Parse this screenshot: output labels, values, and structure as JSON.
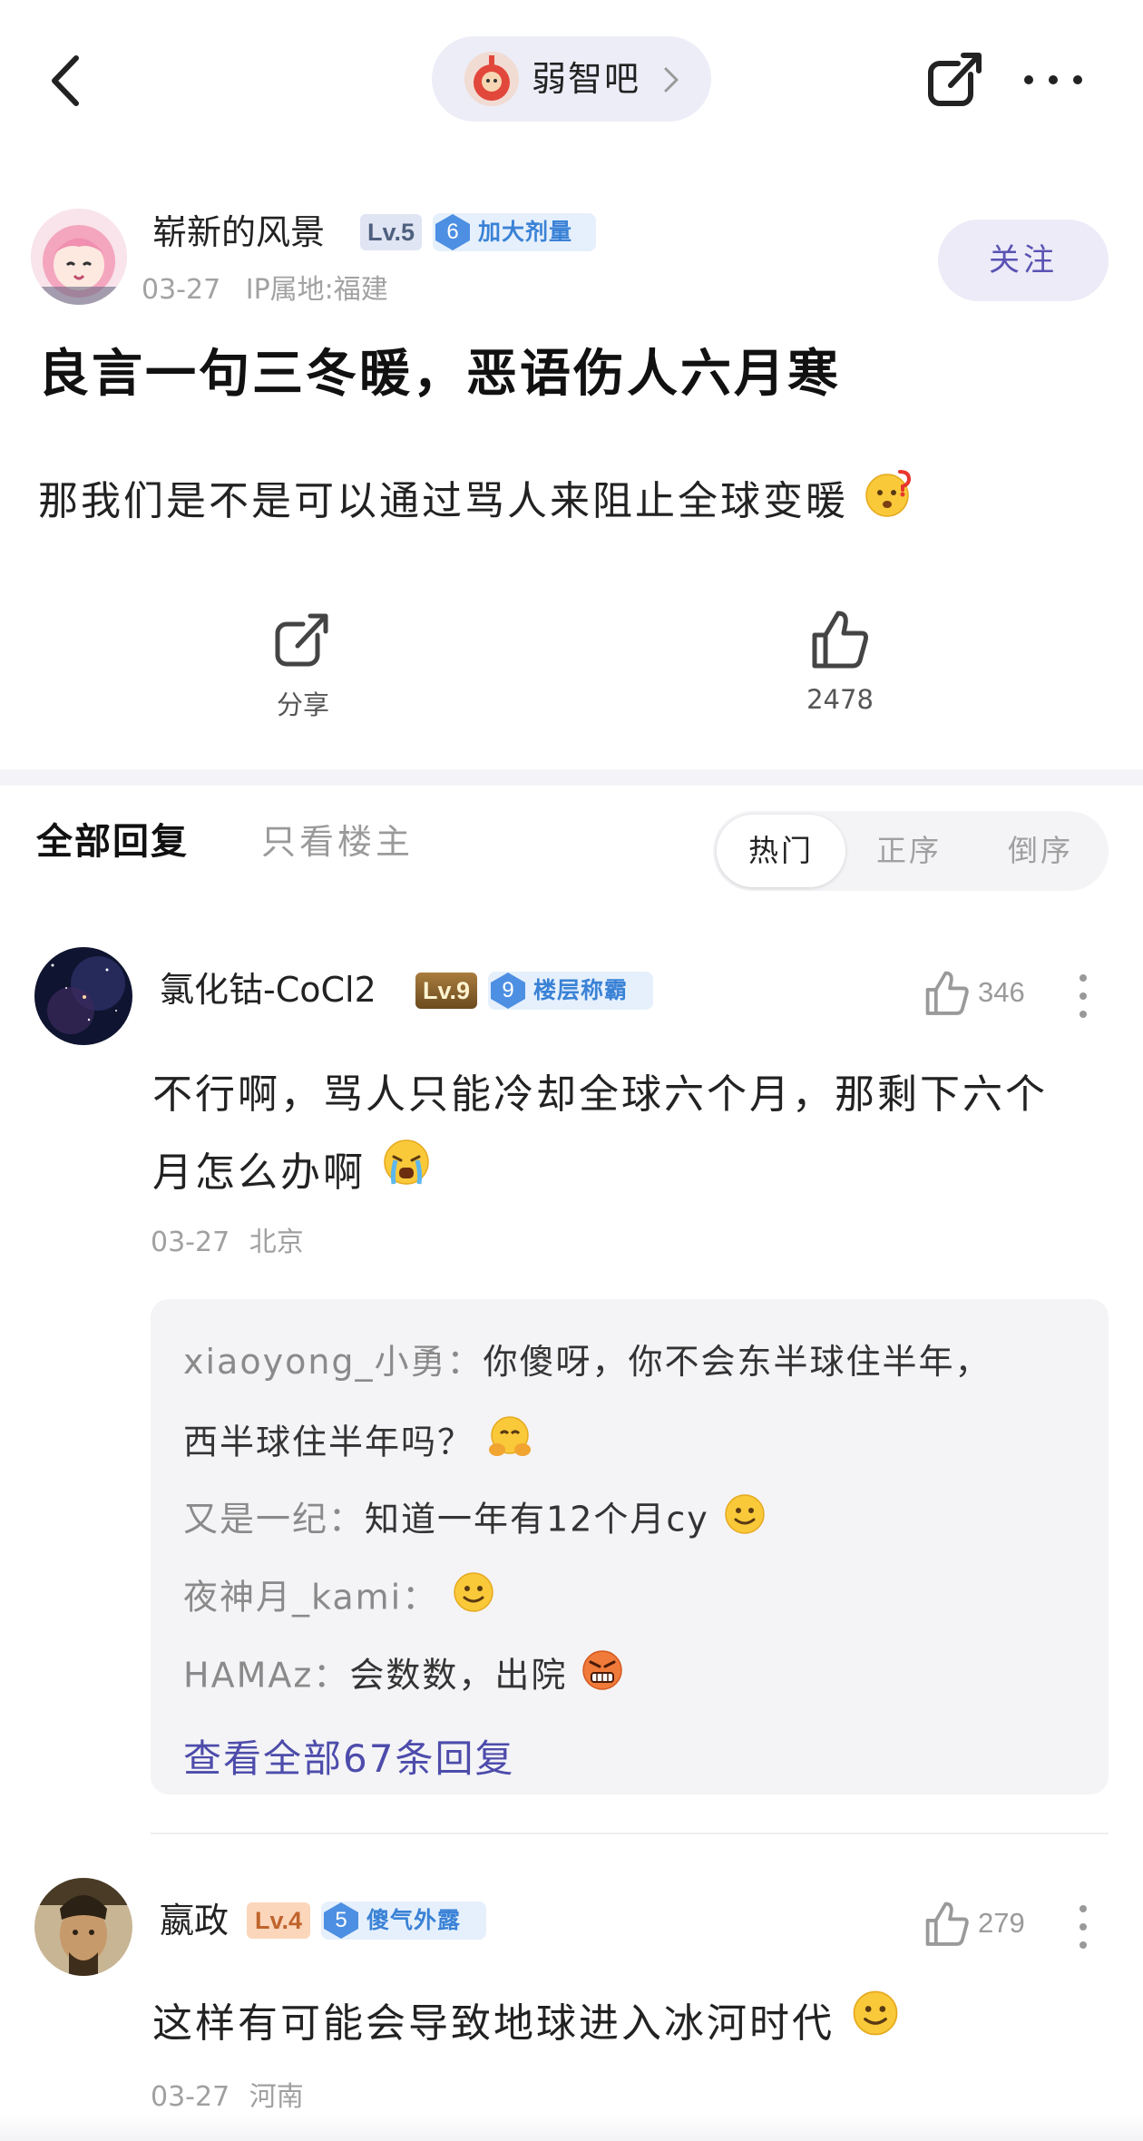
{
  "topbar": {
    "forum_name": "弱智吧"
  },
  "post": {
    "author": {
      "name": "崭新的风景",
      "level": "Lv.5",
      "title_level": "6",
      "title": "加大剂量",
      "date": "03-27",
      "ip": "IP属地:福建",
      "follow_label": "关注"
    },
    "title": "良言一句三冬暖，恶语伤人六月寒",
    "body": "那我们是不是可以通过骂人来阻止全球变暖",
    "actions": {
      "share_label": "分享",
      "like_count": "2478"
    }
  },
  "tabs": {
    "all_replies": "全部回复",
    "op_only": "只看楼主",
    "sort": [
      "热门",
      "正序",
      "倒序"
    ],
    "active_sort": "热门"
  },
  "comments": [
    {
      "name": "氯化钴-CoCl2",
      "level": "Lv.9",
      "title_level": "9",
      "title": "楼层称霸",
      "likes": "346",
      "text_line1": "不行啊，骂人只能冷却全球六个月，那剩下六个",
      "text_line2": "月怎么办啊",
      "date": "03-27",
      "location": "北京",
      "replies": [
        {
          "user": "xiaoyong_小勇：",
          "text": "你傻呀，你不会东半球住半年，",
          "text_cont": "西半球住半年吗？"
        },
        {
          "user": "又是一纪：",
          "text": "知道一年有12个月cy"
        },
        {
          "user": "夜神月_kami：",
          "text": ""
        },
        {
          "user": "HAMAz：",
          "text": "会数数，出院"
        }
      ],
      "view_all": "查看全部67条回复"
    },
    {
      "name": "嬴政",
      "level": "Lv.4",
      "title_level": "5",
      "title": "傻气外露",
      "likes": "279",
      "text": "这样有可能会导致地球进入冰河时代",
      "date": "03-27",
      "location": "河南"
    }
  ],
  "colors": {
    "accent": "#4d4cab",
    "follow_bg": "#ecebf7",
    "badge_blue": "#3a82d6"
  },
  "icons": [
    "back-icon",
    "chevron-right-icon",
    "share-icon",
    "more-icon",
    "thumbs-up-icon",
    "more-vertical-icon",
    "thinking-emoji",
    "crying-emoji",
    "hug-emoji",
    "smile-emoji",
    "angry-emoji"
  ]
}
